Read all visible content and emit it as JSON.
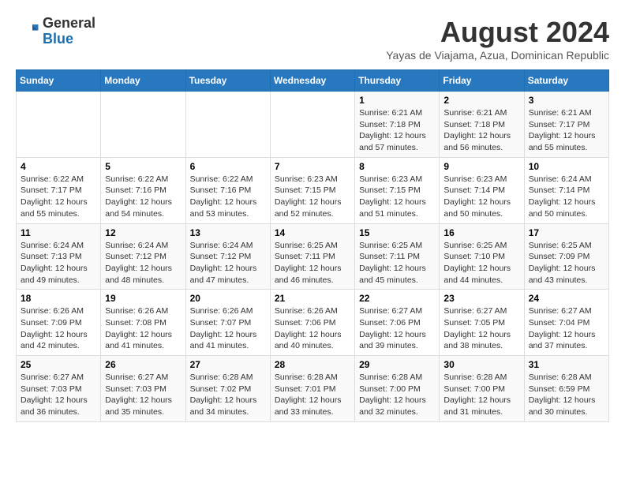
{
  "header": {
    "logo": {
      "line1": "General",
      "line2": "Blue"
    },
    "title": "August 2024",
    "location": "Yayas de Viajama, Azua, Dominican Republic"
  },
  "days_of_week": [
    "Sunday",
    "Monday",
    "Tuesday",
    "Wednesday",
    "Thursday",
    "Friday",
    "Saturday"
  ],
  "weeks": [
    [
      {
        "day": "",
        "info": ""
      },
      {
        "day": "",
        "info": ""
      },
      {
        "day": "",
        "info": ""
      },
      {
        "day": "",
        "info": ""
      },
      {
        "day": "1",
        "info": "Sunrise: 6:21 AM\nSunset: 7:18 PM\nDaylight: 12 hours and 57 minutes."
      },
      {
        "day": "2",
        "info": "Sunrise: 6:21 AM\nSunset: 7:18 PM\nDaylight: 12 hours and 56 minutes."
      },
      {
        "day": "3",
        "info": "Sunrise: 6:21 AM\nSunset: 7:17 PM\nDaylight: 12 hours and 55 minutes."
      }
    ],
    [
      {
        "day": "4",
        "info": "Sunrise: 6:22 AM\nSunset: 7:17 PM\nDaylight: 12 hours and 55 minutes."
      },
      {
        "day": "5",
        "info": "Sunrise: 6:22 AM\nSunset: 7:16 PM\nDaylight: 12 hours and 54 minutes."
      },
      {
        "day": "6",
        "info": "Sunrise: 6:22 AM\nSunset: 7:16 PM\nDaylight: 12 hours and 53 minutes."
      },
      {
        "day": "7",
        "info": "Sunrise: 6:23 AM\nSunset: 7:15 PM\nDaylight: 12 hours and 52 minutes."
      },
      {
        "day": "8",
        "info": "Sunrise: 6:23 AM\nSunset: 7:15 PM\nDaylight: 12 hours and 51 minutes."
      },
      {
        "day": "9",
        "info": "Sunrise: 6:23 AM\nSunset: 7:14 PM\nDaylight: 12 hours and 50 minutes."
      },
      {
        "day": "10",
        "info": "Sunrise: 6:24 AM\nSunset: 7:14 PM\nDaylight: 12 hours and 50 minutes."
      }
    ],
    [
      {
        "day": "11",
        "info": "Sunrise: 6:24 AM\nSunset: 7:13 PM\nDaylight: 12 hours and 49 minutes."
      },
      {
        "day": "12",
        "info": "Sunrise: 6:24 AM\nSunset: 7:12 PM\nDaylight: 12 hours and 48 minutes."
      },
      {
        "day": "13",
        "info": "Sunrise: 6:24 AM\nSunset: 7:12 PM\nDaylight: 12 hours and 47 minutes."
      },
      {
        "day": "14",
        "info": "Sunrise: 6:25 AM\nSunset: 7:11 PM\nDaylight: 12 hours and 46 minutes."
      },
      {
        "day": "15",
        "info": "Sunrise: 6:25 AM\nSunset: 7:11 PM\nDaylight: 12 hours and 45 minutes."
      },
      {
        "day": "16",
        "info": "Sunrise: 6:25 AM\nSunset: 7:10 PM\nDaylight: 12 hours and 44 minutes."
      },
      {
        "day": "17",
        "info": "Sunrise: 6:25 AM\nSunset: 7:09 PM\nDaylight: 12 hours and 43 minutes."
      }
    ],
    [
      {
        "day": "18",
        "info": "Sunrise: 6:26 AM\nSunset: 7:09 PM\nDaylight: 12 hours and 42 minutes."
      },
      {
        "day": "19",
        "info": "Sunrise: 6:26 AM\nSunset: 7:08 PM\nDaylight: 12 hours and 41 minutes."
      },
      {
        "day": "20",
        "info": "Sunrise: 6:26 AM\nSunset: 7:07 PM\nDaylight: 12 hours and 41 minutes."
      },
      {
        "day": "21",
        "info": "Sunrise: 6:26 AM\nSunset: 7:06 PM\nDaylight: 12 hours and 40 minutes."
      },
      {
        "day": "22",
        "info": "Sunrise: 6:27 AM\nSunset: 7:06 PM\nDaylight: 12 hours and 39 minutes."
      },
      {
        "day": "23",
        "info": "Sunrise: 6:27 AM\nSunset: 7:05 PM\nDaylight: 12 hours and 38 minutes."
      },
      {
        "day": "24",
        "info": "Sunrise: 6:27 AM\nSunset: 7:04 PM\nDaylight: 12 hours and 37 minutes."
      }
    ],
    [
      {
        "day": "25",
        "info": "Sunrise: 6:27 AM\nSunset: 7:03 PM\nDaylight: 12 hours and 36 minutes."
      },
      {
        "day": "26",
        "info": "Sunrise: 6:27 AM\nSunset: 7:03 PM\nDaylight: 12 hours and 35 minutes."
      },
      {
        "day": "27",
        "info": "Sunrise: 6:28 AM\nSunset: 7:02 PM\nDaylight: 12 hours and 34 minutes."
      },
      {
        "day": "28",
        "info": "Sunrise: 6:28 AM\nSunset: 7:01 PM\nDaylight: 12 hours and 33 minutes."
      },
      {
        "day": "29",
        "info": "Sunrise: 6:28 AM\nSunset: 7:00 PM\nDaylight: 12 hours and 32 minutes."
      },
      {
        "day": "30",
        "info": "Sunrise: 6:28 AM\nSunset: 7:00 PM\nDaylight: 12 hours and 31 minutes."
      },
      {
        "day": "31",
        "info": "Sunrise: 6:28 AM\nSunset: 6:59 PM\nDaylight: 12 hours and 30 minutes."
      }
    ]
  ]
}
